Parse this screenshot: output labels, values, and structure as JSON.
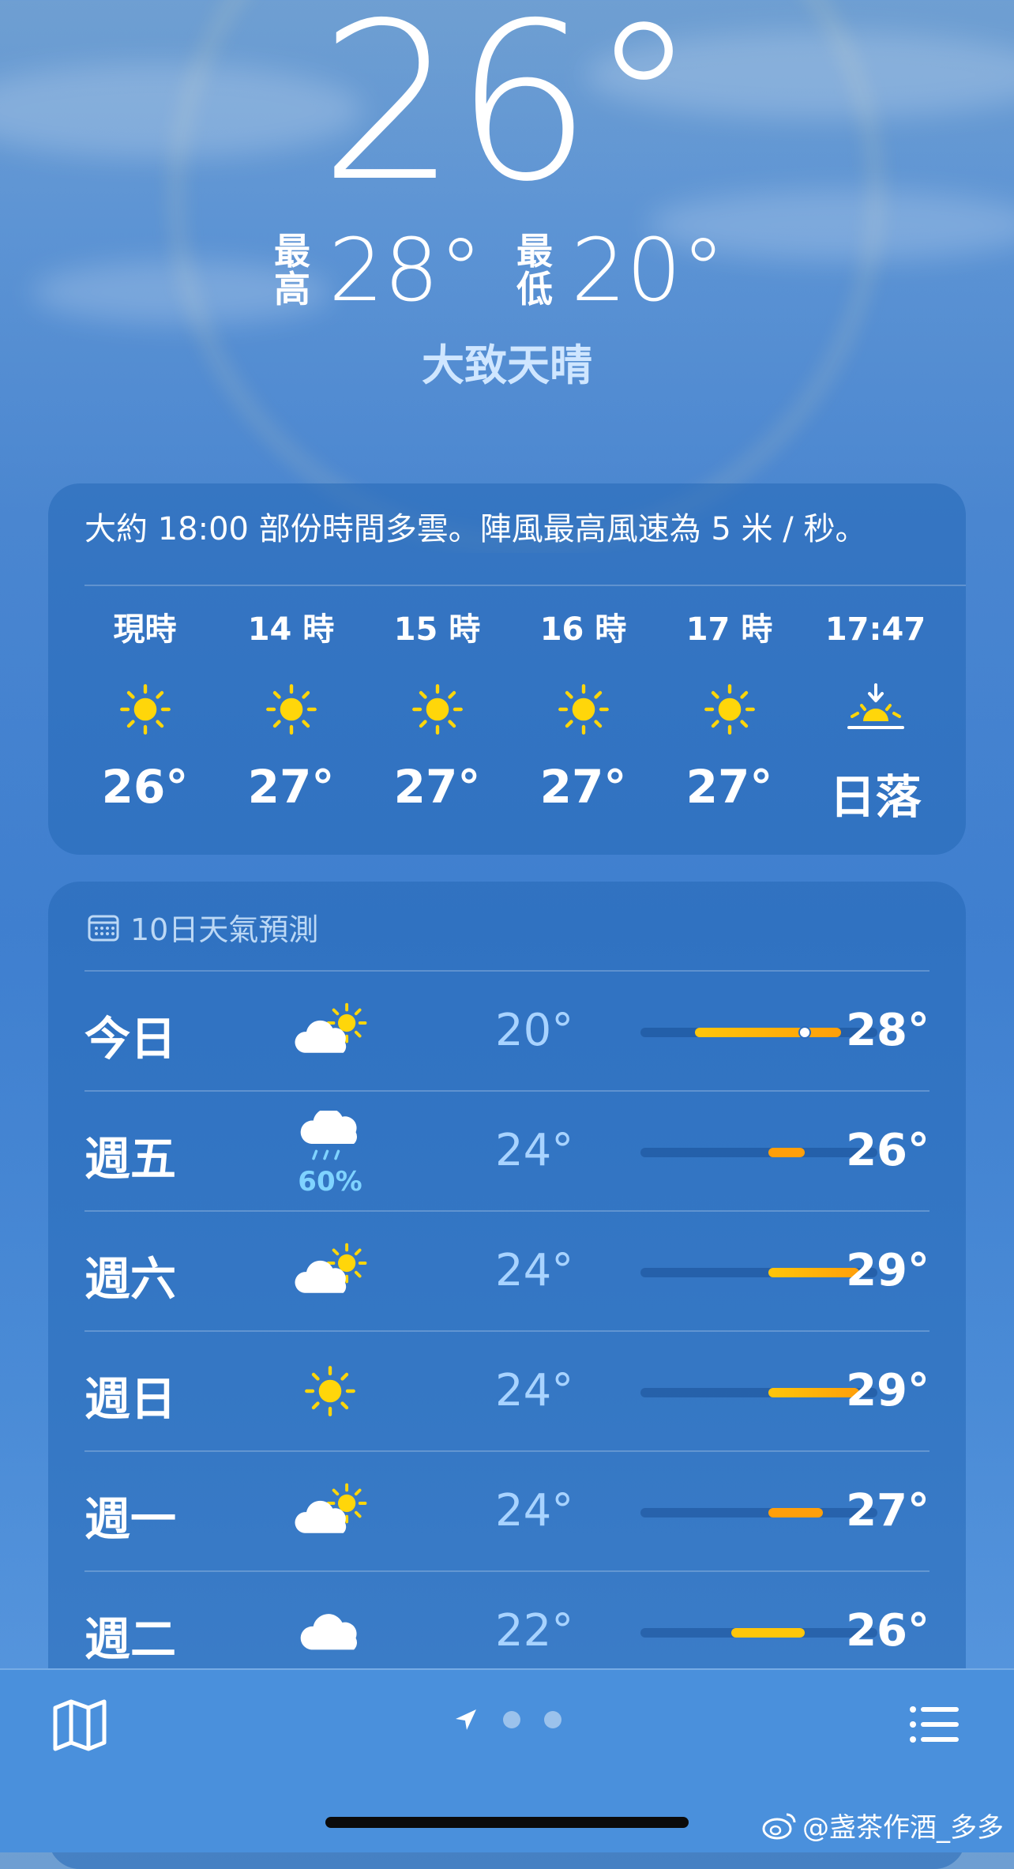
{
  "current": {
    "temperature": "26°",
    "high_label": "最高",
    "high": "28°",
    "low_label": "最低",
    "low": "20°",
    "condition": "大致天晴"
  },
  "hourly": {
    "summary": "大約 18:00 部份時間多雲。陣風最高風速為 5 米 / 秒。",
    "items": [
      {
        "time": "現時",
        "icon": "sun-icon",
        "temp": "26°"
      },
      {
        "time": "14 時",
        "icon": "sun-icon",
        "temp": "27°"
      },
      {
        "time": "15 時",
        "icon": "sun-icon",
        "temp": "27°"
      },
      {
        "time": "16 時",
        "icon": "sun-icon",
        "temp": "27°"
      },
      {
        "time": "17 時",
        "icon": "sun-icon",
        "temp": "27°"
      },
      {
        "time": "17:47",
        "icon": "sunset-icon",
        "temp": "日落"
      }
    ]
  },
  "daily": {
    "title": "10日天氣預測",
    "rows": [
      {
        "day": "今日",
        "icon": "partly-cloudy-icon",
        "precip": "",
        "low": "20°",
        "high": "28°",
        "range": [
          20,
          28
        ],
        "current": 26
      },
      {
        "day": "週五",
        "icon": "rain-cloud-icon",
        "precip": "60%",
        "low": "24°",
        "high": "26°",
        "range": [
          24,
          26
        ]
      },
      {
        "day": "週六",
        "icon": "partly-cloudy-icon",
        "precip": "",
        "low": "24°",
        "high": "29°",
        "range": [
          24,
          29
        ]
      },
      {
        "day": "週日",
        "icon": "sun-icon",
        "precip": "",
        "low": "24°",
        "high": "29°",
        "range": [
          24,
          29
        ]
      },
      {
        "day": "週一",
        "icon": "partly-cloudy-icon",
        "precip": "",
        "low": "24°",
        "high": "27°",
        "range": [
          24,
          27
        ]
      },
      {
        "day": "週二",
        "icon": "cloud-icon",
        "precip": "",
        "low": "22°",
        "high": "26°",
        "range": [
          22,
          26
        ]
      }
    ],
    "scale": [
      17,
      30
    ]
  },
  "bottom_bar": {
    "map_icon": "map-icon",
    "location_icon": "location-arrow-icon",
    "page_count": 3,
    "list_icon": "list-icon"
  },
  "watermark": "@盏茶作酒_多多",
  "colors": {
    "sun": "#FFD60A",
    "bar_warm": "#FF9F0A",
    "bar_yellow": "#FFC60A",
    "low_temp": "#A8D3FF",
    "precip": "#7FD3FF"
  }
}
